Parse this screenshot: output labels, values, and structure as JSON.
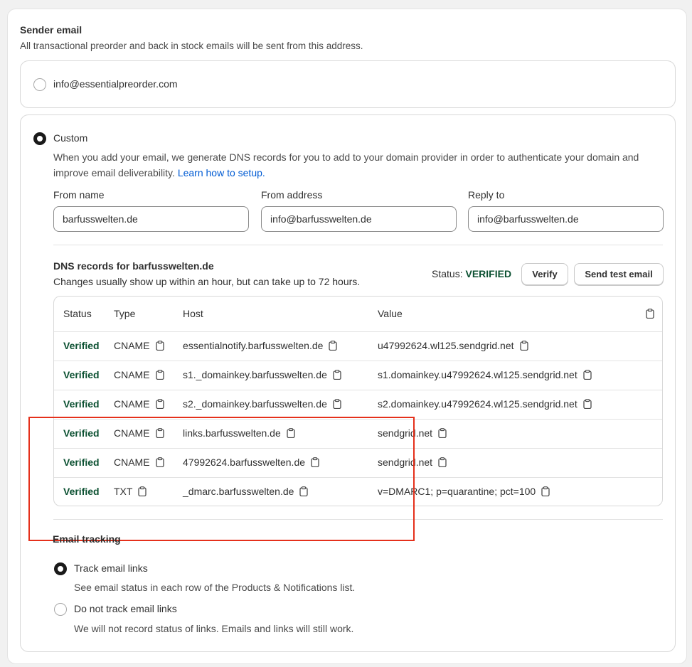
{
  "sender": {
    "title": "Sender email",
    "subtitle": "All transactional preorder and back in stock emails will be sent from this address.",
    "default_option": {
      "label": "info@essentialpreorder.com",
      "selected": false
    },
    "custom_option": {
      "label": "Custom",
      "selected": true,
      "description": "When you add your email, we generate DNS records for you to add to your domain provider in order to authenticate your domain and improve email deliverability.",
      "link_text": "Learn how to setup."
    },
    "fields": {
      "from_name": {
        "label": "From name",
        "value": "barfusswelten.de"
      },
      "from_address": {
        "label": "From address",
        "value": "info@barfusswelten.de"
      },
      "reply_to": {
        "label": "Reply to",
        "value": "info@barfusswelten.de"
      }
    }
  },
  "dns": {
    "title": "DNS records for barfusswelten.de",
    "subtitle": "Changes usually show up within an hour, but can take up to 72 hours.",
    "status_label": "Status:",
    "status_value": "VERIFIED",
    "verify_label": "Verify",
    "send_test_label": "Send test email",
    "columns": [
      "Status",
      "Type",
      "Host",
      "Value"
    ],
    "rows": [
      {
        "status": "Verified",
        "type": "CNAME",
        "host": "essentialnotify.barfusswelten.de",
        "value": "u47992624.wl125.sendgrid.net"
      },
      {
        "status": "Verified",
        "type": "CNAME",
        "host": "s1._domainkey.barfusswelten.de",
        "value": "s1.domainkey.u47992624.wl125.sendgrid.net"
      },
      {
        "status": "Verified",
        "type": "CNAME",
        "host": "s2._domainkey.barfusswelten.de",
        "value": "s2.domainkey.u47992624.wl125.sendgrid.net"
      },
      {
        "status": "Verified",
        "type": "CNAME",
        "host": "links.barfusswelten.de",
        "value": "sendgrid.net"
      },
      {
        "status": "Verified",
        "type": "CNAME",
        "host": "47992624.barfusswelten.de",
        "value": "sendgrid.net"
      },
      {
        "status": "Verified",
        "type": "TXT",
        "host": "_dmarc.barfusswelten.de",
        "value": "v=DMARC1; p=quarantine; pct=100"
      }
    ]
  },
  "tracking": {
    "title": "Email tracking",
    "options": [
      {
        "label": "Track email links",
        "description": "See email status in each row of the Products & Notifications list.",
        "selected": true
      },
      {
        "label": "Do not track email links",
        "description": "We will not record status of links. Emails and links will still work.",
        "selected": false
      }
    ]
  },
  "colors": {
    "verified": "#0c5132",
    "link": "#005bd3",
    "highlight": "#e5301b"
  },
  "icons": {
    "copy": "clipboard-icon"
  }
}
